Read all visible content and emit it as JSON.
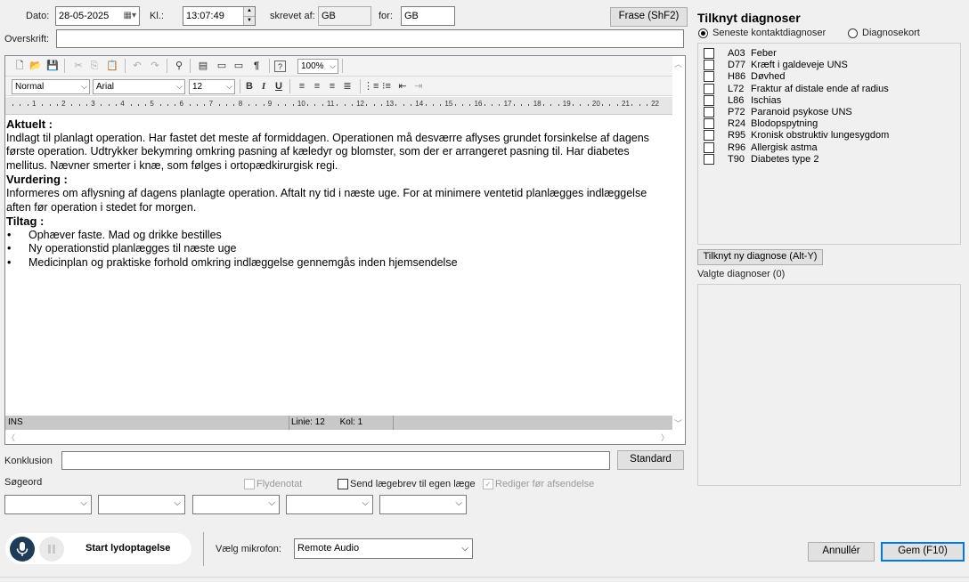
{
  "header": {
    "date_label": "Dato:",
    "date_value": "28-05-2025",
    "time_label": "Kl.:",
    "time_value": "13:07:49",
    "written_by_label": "skrevet af:",
    "written_by_value": "GB",
    "for_label": "for:",
    "for_value": "GB",
    "phrase_button": "Frase (ShF2)",
    "heading_label": "Overskrift:",
    "heading_value": ""
  },
  "toolbar": {
    "zoom": "100%",
    "style": "Normal",
    "font": "Arial",
    "size": "12",
    "bold": "B",
    "italic": "I",
    "underline": "U"
  },
  "ruler": [
    "1",
    "2",
    "3",
    "4",
    "5",
    "6",
    "7",
    "8",
    "9",
    "10",
    "11",
    "12",
    "13",
    "14",
    "15",
    "16",
    "17",
    "18",
    "19",
    "20",
    "21",
    "22"
  ],
  "note": {
    "current_heading": "Aktuelt :",
    "current_text": "Indlagt til planlagt operation. Har fastet det meste af formiddagen. Operationen må desværre aflyses grundet forsinkelse af dagens første operation. Udtrykker bekymring omkring pasning af kæledyr og blomster, som der er arrangeret pasning til. Har diabetes mellitus. Nævner smerter i knæ, som følges i ortopædkirurgisk regi.",
    "assessment_heading": "Vurdering :",
    "assessment_text": "Informeres om aflysning af dagens planlagte operation. Aftalt ny tid i næste uge. For at minimere ventetid planlægges indlæggelse aften før operation i stedet for morgen.",
    "action_heading": "Tiltag :",
    "action_items": [
      "Ophæver faste. Mad og drikke bestilles",
      "Ny operationstid planlægges til næste uge",
      "Medicinplan og praktiske forhold omkring indlæggelse gennemgås inden hjemsendelse"
    ]
  },
  "status_bar": {
    "mode": "INS",
    "line": "Linie: 12",
    "col": "Kol: 1"
  },
  "diagnoses": {
    "title": "Tilknyt diagnoser",
    "radio_recent": "Seneste kontaktdiagnoser",
    "radio_map": "Diagnosekort",
    "selected_radio": "recent",
    "items": [
      {
        "code": "A03",
        "name": "Feber"
      },
      {
        "code": "D77",
        "name": "Kræft i galdeveje UNS"
      },
      {
        "code": "H86",
        "name": "Døvhed"
      },
      {
        "code": "L72",
        "name": "Fraktur af distale ende af radius"
      },
      {
        "code": "L86",
        "name": "Ischias"
      },
      {
        "code": "P72",
        "name": "Paranoid psykose UNS"
      },
      {
        "code": "R24",
        "name": "Blodopspytning"
      },
      {
        "code": "R95",
        "name": "Kronisk obstruktiv lungesygdom"
      },
      {
        "code": "R96",
        "name": "Allergisk astma"
      },
      {
        "code": "T90",
        "name": "Diabetes type 2"
      }
    ],
    "add_button": "Tilknyt ny diagnose (Alt-Y)",
    "selected_label": "Valgte diagnoser (0)"
  },
  "conclusion": {
    "label": "Konklusion",
    "value": "",
    "standard_button": "Standard"
  },
  "keywords": {
    "label": "Søgeord",
    "flydenotat": "Flydenotat",
    "send_letter": "Send lægebrev til egen læge",
    "edit_before_send": "Rediger før afsendelse"
  },
  "audio": {
    "start_label": "Start lydoptagelse",
    "mic_label": "Vælg mikrofon:",
    "mic_value": "Remote Audio"
  },
  "footer": {
    "cancel": "Annullér",
    "save": "Gem (F10)"
  }
}
